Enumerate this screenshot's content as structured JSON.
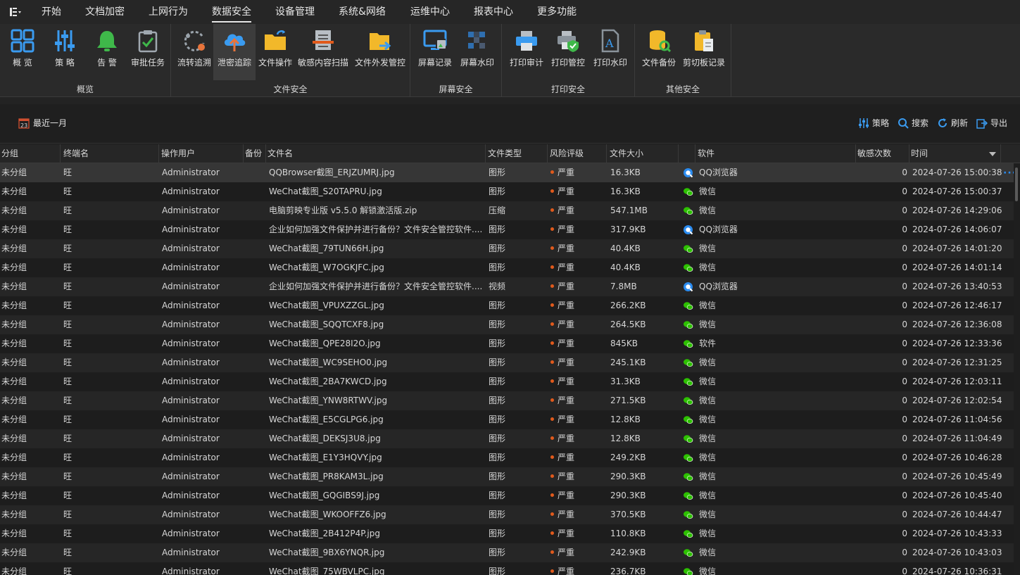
{
  "menu": {
    "items": [
      {
        "label": "开始",
        "active": false
      },
      {
        "label": "文档加密",
        "active": false
      },
      {
        "label": "上网行为",
        "active": false
      },
      {
        "label": "数据安全",
        "active": true
      },
      {
        "label": "设备管理",
        "active": false
      },
      {
        "label": "系统&网络",
        "active": false
      },
      {
        "label": "运维中心",
        "active": false
      },
      {
        "label": "报表中心",
        "active": false
      },
      {
        "label": "更多功能",
        "active": false
      }
    ]
  },
  "ribbon": {
    "groups": [
      {
        "label": "概览",
        "buttons": [
          {
            "label": "概 览",
            "icon": "overview-grid-icon"
          },
          {
            "label": "策 略",
            "icon": "policy-sliders-icon"
          },
          {
            "label": "告 警",
            "icon": "alert-bell-icon"
          },
          {
            "label": "审批任务",
            "icon": "approval-clipboard-icon"
          }
        ]
      },
      {
        "label": "文件安全",
        "buttons": [
          {
            "label": "流转追溯",
            "icon": "flow-trace-icon"
          },
          {
            "label": "泄密追踪",
            "icon": "leak-trace-cloud-icon",
            "active": true
          },
          {
            "label": "文件操作",
            "icon": "file-operation-folder-icon"
          },
          {
            "label": "敏感内容扫描",
            "icon": "sensitive-scan-icon"
          },
          {
            "label": "文件外发管控",
            "icon": "file-outgoing-folder-icon"
          }
        ]
      },
      {
        "label": "屏幕安全",
        "buttons": [
          {
            "label": "屏幕记录",
            "icon": "screen-record-icon"
          },
          {
            "label": "屏幕水印",
            "icon": "screen-watermark-icon"
          }
        ]
      },
      {
        "label": "打印安全",
        "buttons": [
          {
            "label": "打印审计",
            "icon": "print-audit-icon"
          },
          {
            "label": "打印管控",
            "icon": "print-control-icon"
          },
          {
            "label": "打印水印",
            "icon": "print-watermark-icon"
          }
        ]
      },
      {
        "label": "其他安全",
        "buttons": [
          {
            "label": "文件备份",
            "icon": "file-backup-icon"
          },
          {
            "label": "剪切板记录",
            "icon": "clipboard-record-icon"
          }
        ]
      }
    ]
  },
  "toolbar": {
    "date_filter": "最近一月",
    "date_icon_text": "23",
    "actions": [
      {
        "label": "策略",
        "icon": "policy-icon"
      },
      {
        "label": "搜索",
        "icon": "search-icon"
      },
      {
        "label": "刷新",
        "icon": "refresh-icon"
      },
      {
        "label": "导出",
        "icon": "export-icon"
      }
    ]
  },
  "table": {
    "columns": [
      "分组",
      "终端名",
      "操作用户",
      "备份",
      "文件名",
      "文件类型",
      "风险评级",
      "文件大小",
      "",
      "软件",
      "敏感次数",
      "时间"
    ],
    "rows": [
      [
        "未分组",
        "旺",
        "Administrator",
        "",
        "QQBrowser截图_ERJZUMRJ.jpg",
        "图形",
        "严重",
        "16.3KB",
        "qq",
        "QQ浏览器",
        "0",
        "2024-07-26 15:00:38"
      ],
      [
        "未分组",
        "旺",
        "Administrator",
        "",
        "WeChat截图_S20TAPRU.jpg",
        "图形",
        "严重",
        "16.3KB",
        "wechat",
        "微信",
        "0",
        "2024-07-26 15:00:37"
      ],
      [
        "未分组",
        "旺",
        "Administrator",
        "",
        "电脑剪映专业版 v5.5.0 解锁激活版.zip",
        "压缩",
        "严重",
        "547.1MB",
        "wechat",
        "微信",
        "0",
        "2024-07-26 14:29:06"
      ],
      [
        "未分组",
        "旺",
        "Administrator",
        "",
        "企业如何加强文件保护并进行备份？文件安全管控软件....",
        "图形",
        "严重",
        "317.9KB",
        "qq",
        "QQ浏览器",
        "0",
        "2024-07-26 14:06:07"
      ],
      [
        "未分组",
        "旺",
        "Administrator",
        "",
        "WeChat截图_79TUN66H.jpg",
        "图形",
        "严重",
        "40.4KB",
        "wechat",
        "微信",
        "0",
        "2024-07-26 14:01:20"
      ],
      [
        "未分组",
        "旺",
        "Administrator",
        "",
        "WeChat截图_W7OGKJFC.jpg",
        "图形",
        "严重",
        "40.4KB",
        "wechat",
        "微信",
        "0",
        "2024-07-26 14:01:14"
      ],
      [
        "未分组",
        "旺",
        "Administrator",
        "",
        "企业如何加强文件保护并进行备份？文件安全管控软件....",
        "视频",
        "严重",
        "7.8MB",
        "qq",
        "QQ浏览器",
        "0",
        "2024-07-26 13:40:53"
      ],
      [
        "未分组",
        "旺",
        "Administrator",
        "",
        "WeChat截图_VPUXZZGL.jpg",
        "图形",
        "严重",
        "266.2KB",
        "wechat",
        "微信",
        "0",
        "2024-07-26 12:46:17"
      ],
      [
        "未分组",
        "旺",
        "Administrator",
        "",
        "WeChat截图_SQQTCXF8.jpg",
        "图形",
        "严重",
        "264.5KB",
        "wechat",
        "微信",
        "0",
        "2024-07-26 12:36:08"
      ],
      [
        "未分组",
        "旺",
        "Administrator",
        "",
        "WeChat截图_QPE28I2O.jpg",
        "图形",
        "严重",
        "845KB",
        "wechat",
        "软件",
        "0",
        "2024-07-26 12:33:36"
      ],
      [
        "未分组",
        "旺",
        "Administrator",
        "",
        "WeChat截图_WC9SEHO0.jpg",
        "图形",
        "严重",
        "245.1KB",
        "wechat",
        "微信",
        "0",
        "2024-07-26 12:31:25"
      ],
      [
        "未分组",
        "旺",
        "Administrator",
        "",
        "WeChat截图_2BA7KWCD.jpg",
        "图形",
        "严重",
        "31.3KB",
        "wechat",
        "微信",
        "0",
        "2024-07-26 12:03:11"
      ],
      [
        "未分组",
        "旺",
        "Administrator",
        "",
        "WeChat截图_YNW8RTWV.jpg",
        "图形",
        "严重",
        "271.5KB",
        "wechat",
        "微信",
        "0",
        "2024-07-26 12:02:54"
      ],
      [
        "未分组",
        "旺",
        "Administrator",
        "",
        "WeChat截图_E5CGLPG6.jpg",
        "图形",
        "严重",
        "12.8KB",
        "wechat",
        "微信",
        "0",
        "2024-07-26 11:04:56"
      ],
      [
        "未分组",
        "旺",
        "Administrator",
        "",
        "WeChat截图_DEKSJ3U8.jpg",
        "图形",
        "严重",
        "12.8KB",
        "wechat",
        "微信",
        "0",
        "2024-07-26 11:04:49"
      ],
      [
        "未分组",
        "旺",
        "Administrator",
        "",
        "WeChat截图_E1Y3HQVY.jpg",
        "图形",
        "严重",
        "249.2KB",
        "wechat",
        "微信",
        "0",
        "2024-07-26 10:46:28"
      ],
      [
        "未分组",
        "旺",
        "Administrator",
        "",
        "WeChat截图_PR8KAM3L.jpg",
        "图形",
        "严重",
        "290.3KB",
        "wechat",
        "微信",
        "0",
        "2024-07-26 10:45:49"
      ],
      [
        "未分组",
        "旺",
        "Administrator",
        "",
        "WeChat截图_GQGIBS9J.jpg",
        "图形",
        "严重",
        "290.3KB",
        "wechat",
        "微信",
        "0",
        "2024-07-26 10:45:40"
      ],
      [
        "未分组",
        "旺",
        "Administrator",
        "",
        "WeChat截图_WKOOFFZ6.jpg",
        "图形",
        "严重",
        "370.5KB",
        "wechat",
        "微信",
        "0",
        "2024-07-26 10:44:47"
      ],
      [
        "未分组",
        "旺",
        "Administrator",
        "",
        "WeChat截图_2B412P4P.jpg",
        "图形",
        "严重",
        "110.8KB",
        "wechat",
        "微信",
        "0",
        "2024-07-26 10:43:33"
      ],
      [
        "未分组",
        "旺",
        "Administrator",
        "",
        "WeChat截图_9BX6YNQR.jpg",
        "图形",
        "严重",
        "242.9KB",
        "wechat",
        "微信",
        "0",
        "2024-07-26 10:43:03"
      ],
      [
        "未分组",
        "旺",
        "Administrator",
        "",
        "WeChat截图_75WBVLPC.jpg",
        "图形",
        "严重",
        "236.7KB",
        "wechat",
        "微信",
        "0",
        "2024-07-26 10:36:31"
      ]
    ]
  },
  "colors": {
    "risk_severe": "#e05a1c",
    "accent_blue": "#2b8cf0",
    "wechat_green": "#2dc100"
  }
}
